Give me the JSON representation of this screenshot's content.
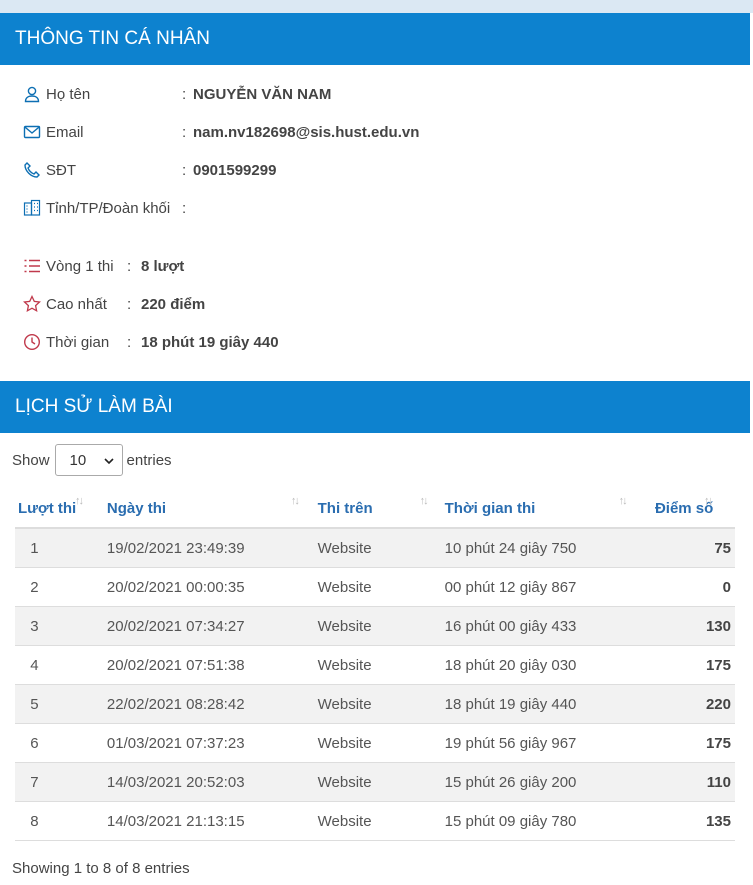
{
  "personal": {
    "header": "THÔNG TIN CÁ NHÂN",
    "fields": [
      {
        "icon": "user-icon",
        "label": "Họ tên",
        "value": "NGUYỄN VĂN NAM"
      },
      {
        "icon": "envelope-icon",
        "label": "Email",
        "value": "nam.nv182698@sis.hust.edu.vn"
      },
      {
        "icon": "phone-icon",
        "label": "SĐT",
        "value": "0901599299"
      },
      {
        "icon": "building-icon",
        "label": "Tỉnh/TP/Đoàn khối",
        "value": ""
      }
    ],
    "stats": [
      {
        "icon": "list-icon",
        "label": "Vòng 1 thi",
        "value": "8 lượt"
      },
      {
        "icon": "star-icon",
        "label": "Cao nhất",
        "value": "220 điểm"
      },
      {
        "icon": "clock-icon",
        "label": "Thời gian",
        "value": "18 phút 19 giây 440"
      }
    ],
    "colon": ":"
  },
  "history": {
    "header": "LỊCH SỬ LÀM BÀI",
    "show_label": "Show",
    "entries_label": "entries",
    "page_size": "10",
    "columns": [
      "Lượt thi",
      "Ngày thi",
      "Thi trên",
      "Thời gian thi",
      "Điểm số"
    ],
    "rows": [
      [
        "1",
        "19/02/2021 23:49:39",
        "Website",
        "10 phút 24 giây 750",
        "75"
      ],
      [
        "2",
        "20/02/2021 00:00:35",
        "Website",
        "00 phút 12 giây 867",
        "0"
      ],
      [
        "3",
        "20/02/2021 07:34:27",
        "Website",
        "16 phút 00 giây 433",
        "130"
      ],
      [
        "4",
        "20/02/2021 07:51:38",
        "Website",
        "18 phút 20 giây 030",
        "175"
      ],
      [
        "5",
        "22/02/2021 08:28:42",
        "Website",
        "18 phút 19 giây 440",
        "220"
      ],
      [
        "6",
        "01/03/2021 07:37:23",
        "Website",
        "19 phút 56 giây 967",
        "175"
      ],
      [
        "7",
        "14/03/2021 20:52:03",
        "Website",
        "15 phút 26 giây 200",
        "110"
      ],
      [
        "8",
        "14/03/2021 21:13:15",
        "Website",
        "15 phút 09 giây 780",
        "135"
      ]
    ],
    "footer": "Showing 1 to 8 of 8 entries"
  },
  "colors": {
    "header_bg": "#0d82cf",
    "link_blue": "#2a6db0",
    "icon_blue": "#0d6fb3",
    "icon_red": "#c0394b"
  }
}
